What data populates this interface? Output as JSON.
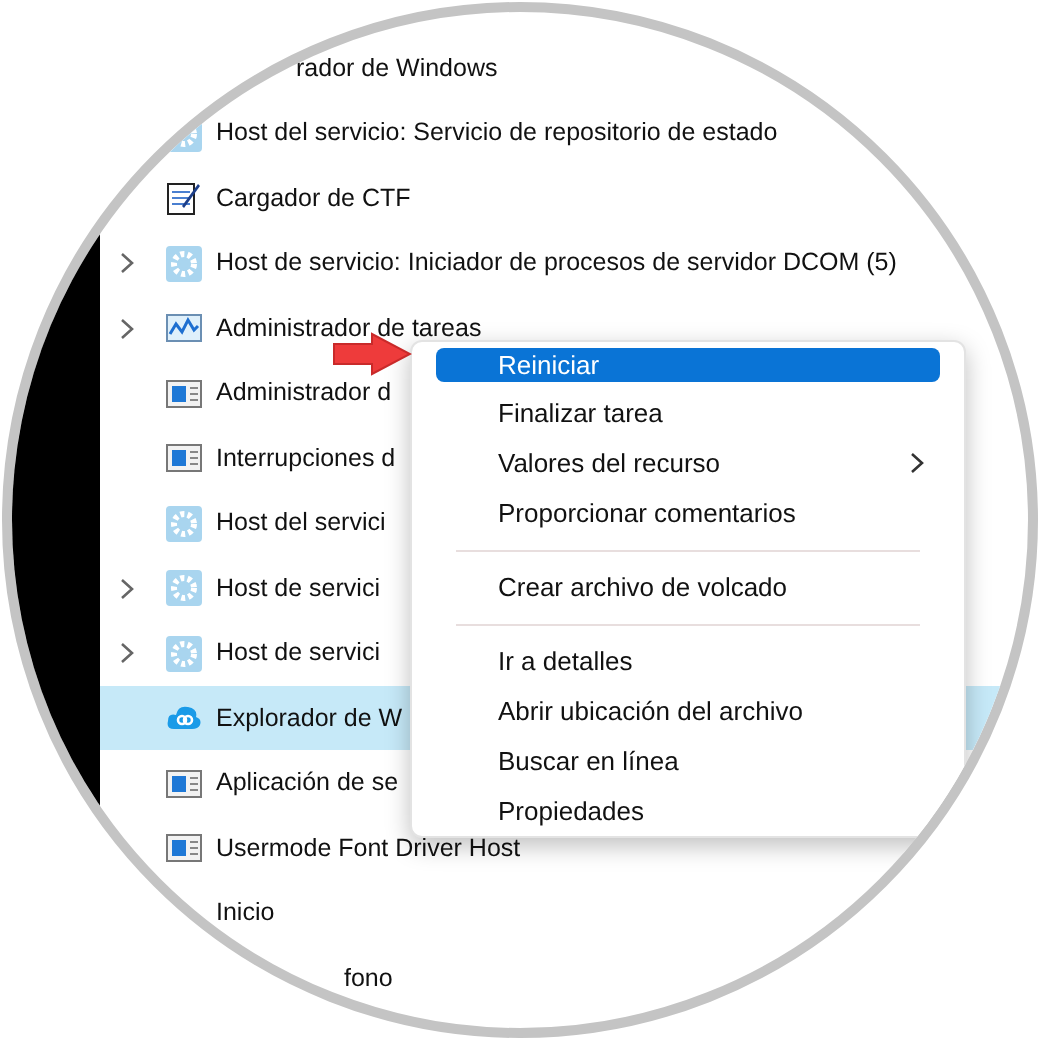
{
  "processes": [
    {
      "name": "rador de Windows",
      "kind": "cut",
      "expandable": false,
      "selected": false
    },
    {
      "name": "Host del servicio: Servicio de repositorio de estado",
      "kind": "gear",
      "expandable": false,
      "selected": false
    },
    {
      "name": "Cargador de CTF",
      "kind": "notepad",
      "expandable": false,
      "selected": false
    },
    {
      "name": "Host de servicio: Iniciador de procesos de servidor DCOM (5)",
      "kind": "gear",
      "expandable": true,
      "selected": false
    },
    {
      "name": "Administrador de tareas",
      "kind": "chart",
      "expandable": true,
      "selected": false
    },
    {
      "name": "Administrador d",
      "kind": "window",
      "expandable": false,
      "selected": false
    },
    {
      "name": "Interrupciones d",
      "kind": "window",
      "expandable": false,
      "selected": false
    },
    {
      "name": "Host del servici",
      "kind": "gear",
      "expandable": false,
      "selected": false
    },
    {
      "name": "Host de servici",
      "kind": "gear",
      "expandable": true,
      "selected": false
    },
    {
      "name": "Host de servici",
      "kind": "gear",
      "expandable": true,
      "selected": false
    },
    {
      "name": "Explorador de W",
      "kind": "cloud",
      "expandable": false,
      "selected": true
    },
    {
      "name": "Aplicación de se",
      "kind": "window",
      "expandable": false,
      "selected": false
    },
    {
      "name": "Usermode Font Driver Host",
      "kind": "window",
      "expandable": false,
      "selected": false
    },
    {
      "name": "Inicio",
      "kind": "plain",
      "expandable": false,
      "selected": false
    },
    {
      "name": "fono",
      "kind": "cut",
      "expandable": false,
      "selected": false
    }
  ],
  "context_menu": [
    {
      "kind": "item",
      "label": "Reiniciar",
      "selected": true,
      "submenu": false
    },
    {
      "kind": "item",
      "label": "Finalizar tarea",
      "selected": false,
      "submenu": false
    },
    {
      "kind": "item",
      "label": "Valores del recurso",
      "selected": false,
      "submenu": true
    },
    {
      "kind": "item",
      "label": "Proporcionar comentarios",
      "selected": false,
      "submenu": false
    },
    {
      "kind": "separator"
    },
    {
      "kind": "item",
      "label": "Crear archivo de volcado",
      "selected": false,
      "submenu": false
    },
    {
      "kind": "separator"
    },
    {
      "kind": "item",
      "label": "Ir a detalles",
      "selected": false,
      "submenu": false
    },
    {
      "kind": "item",
      "label": "Abrir ubicación del archivo",
      "selected": false,
      "submenu": false
    },
    {
      "kind": "item",
      "label": "Buscar en línea",
      "selected": false,
      "submenu": false
    },
    {
      "kind": "item",
      "label": "Propiedades",
      "selected": false,
      "submenu": false
    }
  ]
}
